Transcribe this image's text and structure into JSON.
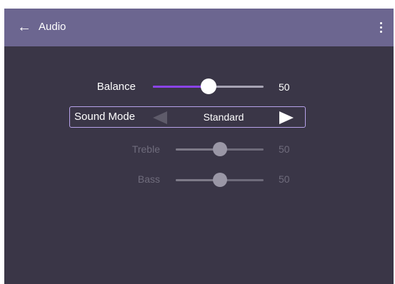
{
  "header": {
    "back_icon": "←",
    "title": "Audio"
  },
  "balance": {
    "label": "Balance",
    "value": "50",
    "level_percent": 50,
    "accent": "#8a43e8"
  },
  "sound_mode": {
    "label": "Sound Mode",
    "value": "Standard",
    "border_color": "#b7a2ea"
  },
  "treble": {
    "label": "Treble",
    "value": "50",
    "level_percent": 50,
    "enabled": false
  },
  "bass": {
    "label": "Bass",
    "value": "50",
    "level_percent": 50,
    "enabled": false
  },
  "colors": {
    "topbar": "#6c6690",
    "background": "#3a3647"
  }
}
